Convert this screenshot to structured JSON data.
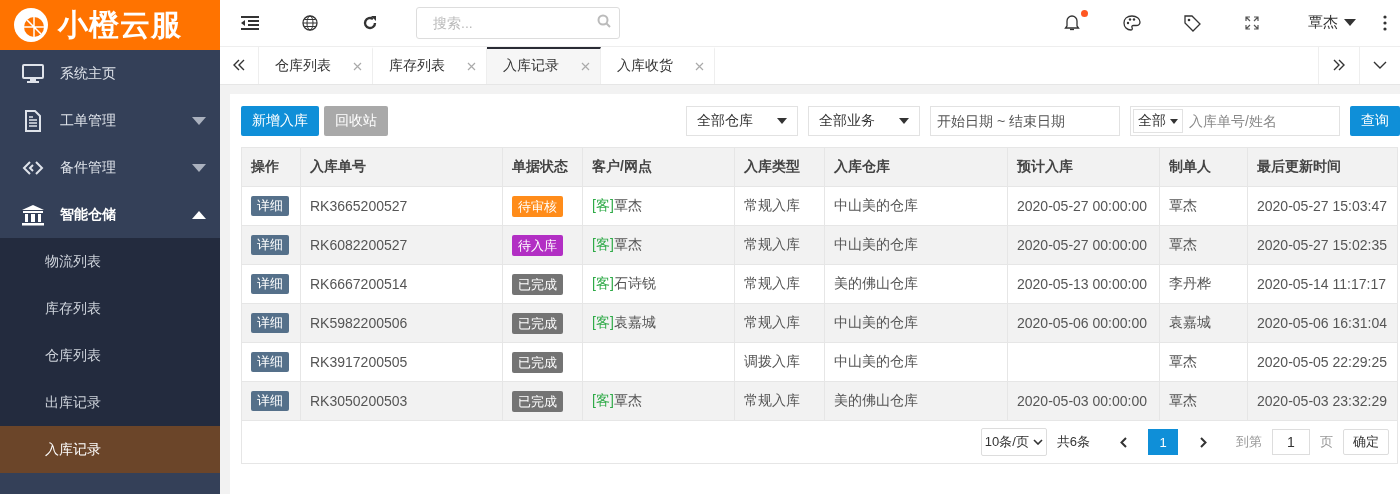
{
  "brand": {
    "name": "小橙云服"
  },
  "sidebar": {
    "items": [
      {
        "label": "系统主页",
        "kind": "link",
        "expanded": false
      },
      {
        "label": "工单管理",
        "kind": "group",
        "expanded": false
      },
      {
        "label": "备件管理",
        "kind": "group",
        "expanded": false
      },
      {
        "label": "智能仓储",
        "kind": "group",
        "expanded": true,
        "children": [
          {
            "label": "物流列表",
            "selected": false
          },
          {
            "label": "库存列表",
            "selected": false
          },
          {
            "label": "仓库列表",
            "selected": false
          },
          {
            "label": "出库记录",
            "selected": false
          },
          {
            "label": "入库记录",
            "selected": true
          }
        ]
      }
    ]
  },
  "header": {
    "search": {
      "placeholder": "搜索..."
    },
    "notification_dot": true,
    "user": "覃杰"
  },
  "tabs": [
    {
      "label": "仓库列表",
      "selected": false
    },
    {
      "label": "库存列表",
      "selected": false
    },
    {
      "label": "入库记录",
      "selected": true
    },
    {
      "label": "入库收货",
      "selected": false
    }
  ],
  "toolbar": {
    "buttons": [
      {
        "label": "新增入库",
        "kind": "primary"
      },
      {
        "label": "回收站",
        "kind": "secondary"
      }
    ],
    "filters": [
      {
        "value": "全部仓库"
      },
      {
        "value": "全部业务"
      }
    ],
    "date_range": {
      "placeholder": "开始日期 ~ 结束日期"
    },
    "scope": {
      "value": "全部"
    },
    "keyword": {
      "placeholder": "入库单号/姓名"
    },
    "query_button": "查询"
  },
  "table": {
    "columns": [
      "操作",
      "入库单号",
      "单据状态",
      "客户/网点",
      "入库类型",
      "入库仓库",
      "预计入库",
      "制单人",
      "最后更新时间"
    ],
    "rows": [
      {
        "action": "详细",
        "number": "RK3665200527",
        "status": {
          "label": "待审核",
          "color": "#ff8c1a"
        },
        "customer": {
          "tag": "[客]",
          "name": "覃杰"
        },
        "type": "常规入库",
        "warehouse": "中山美的仓库",
        "expected": "2020-05-27 00:00:00",
        "creator": "覃杰",
        "updated": "2020-05-27 15:03:47"
      },
      {
        "action": "详细",
        "number": "RK6082200527",
        "status": {
          "label": "待入库",
          "color": "#b22fc4"
        },
        "customer": {
          "tag": "[客]",
          "name": "覃杰"
        },
        "type": "常规入库",
        "warehouse": "中山美的仓库",
        "expected": "2020-05-27 00:00:00",
        "creator": "覃杰",
        "updated": "2020-05-27 15:02:35"
      },
      {
        "action": "详细",
        "number": "RK6667200514",
        "status": {
          "label": "已完成",
          "color": "#747474"
        },
        "customer": {
          "tag": "[客]",
          "name": "石诗锐"
        },
        "type": "常规入库",
        "warehouse": "美的佛山仓库",
        "expected": "2020-05-13 00:00:00",
        "creator": "李丹桦",
        "updated": "2020-05-14 11:17:17"
      },
      {
        "action": "详细",
        "number": "RK5982200506",
        "status": {
          "label": "已完成",
          "color": "#747474"
        },
        "customer": {
          "tag": "[客]",
          "name": "袁嘉城"
        },
        "type": "常规入库",
        "warehouse": "中山美的仓库",
        "expected": "2020-05-06 00:00:00",
        "creator": "袁嘉城",
        "updated": "2020-05-06 16:31:04"
      },
      {
        "action": "详细",
        "number": "RK3917200505",
        "status": {
          "label": "已完成",
          "color": "#747474"
        },
        "type": "调拨入库",
        "warehouse": "中山美的仓库",
        "creator": "覃杰",
        "updated": "2020-05-05 22:29:25"
      },
      {
        "action": "详细",
        "number": "RK3050200503",
        "status": {
          "label": "已完成",
          "color": "#747474"
        },
        "customer": {
          "tag": "[客]",
          "name": "覃杰"
        },
        "type": "常规入库",
        "warehouse": "美的佛山仓库",
        "expected": "2020-05-03 00:00:00",
        "creator": "覃杰",
        "updated": "2020-05-03 23:32:29"
      }
    ]
  },
  "pagination": {
    "page_size": "10条/页",
    "total": "共6条",
    "pages": [
      {
        "label": "1",
        "selected": true
      }
    ],
    "goto_label": "到第",
    "goto_value": "1",
    "page_unit": "页",
    "confirm": "确定"
  }
}
